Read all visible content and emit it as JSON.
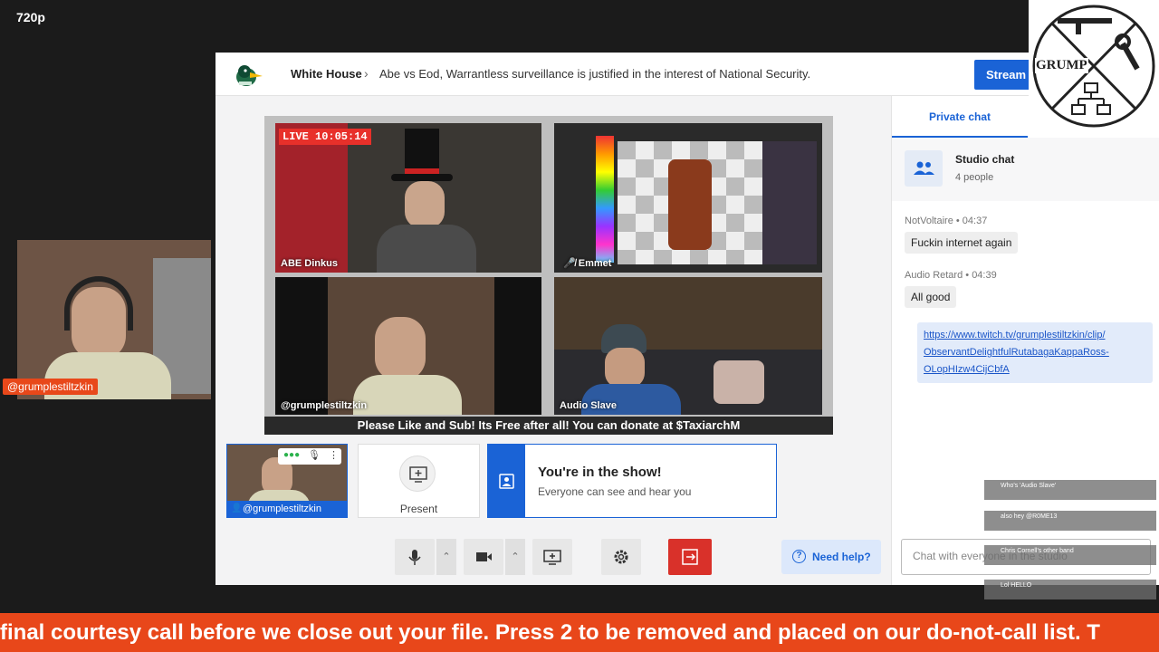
{
  "stream": {
    "quality": "720p",
    "host_tag": "@grumplestiltzkin"
  },
  "studio": {
    "crumb_studio": "White House",
    "crumb_title": "Abe vs Eod, Warrantless surveillance is justified in the interest of National Security.",
    "stream_button": "Stream"
  },
  "stage": {
    "live_badge": "LIVE 10:05:14",
    "tiles": [
      {
        "label": "ABE Dinkus"
      },
      {
        "label": "Emmet"
      },
      {
        "label": "@grumplestiltzkin"
      },
      {
        "label": "Audio Slave"
      }
    ],
    "ticker": "Please Like and Sub! Its Free after all! You can donate at $TaxiarchM"
  },
  "guest": {
    "name": "@grumplestiltzkin"
  },
  "present": {
    "label": "Present"
  },
  "inshow": {
    "title": "You're in the show!",
    "subtitle": "Everyone can see and hear you"
  },
  "help": {
    "label": "Need help?"
  },
  "chat": {
    "tab": "Private chat",
    "studio_chat_title": "Studio chat",
    "studio_chat_people": "4 people",
    "messages": [
      {
        "author": "NotVoltaire",
        "time": "04:37",
        "text": "Fuckin internet again"
      },
      {
        "author": "Audio Retard",
        "time": "04:39",
        "text": "All good"
      }
    ],
    "link_lines": [
      "https://www.twitch.tv/grumplestiltzkin/clip/",
      "ObservantDelightfulRutabagaKappaRoss-",
      "OLopHIzw4CijCbfA"
    ],
    "input_placeholder": "Chat with everyone in the studio"
  },
  "logo": {
    "text": "GRUMP"
  },
  "overlay_chat": [
    {
      "user": "",
      "text": "Who's 'Audio Slave'"
    },
    {
      "user": "",
      "text": "also hey @R0ME13"
    },
    {
      "user": "",
      "text": "Chris Cornell's other band"
    },
    {
      "user": "",
      "text": "Lol HELLO"
    }
  ],
  "banner": {
    "text": "final courtesy call before we close out your file. Press 2 to be removed and placed on our do-not-call list. T"
  },
  "colors": {
    "accent": "#1a63d6",
    "live": "#e8302a",
    "banner": "#e8471a",
    "leave": "#d9312a"
  }
}
